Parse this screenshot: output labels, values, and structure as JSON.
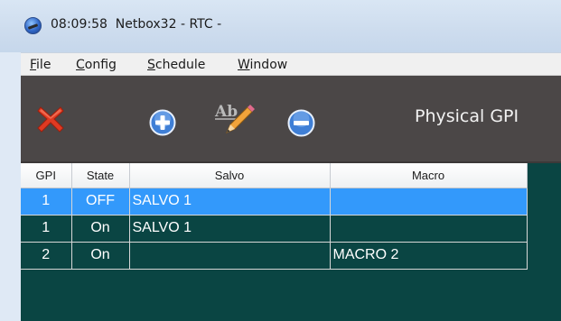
{
  "window": {
    "time": "08:09:58",
    "app": "Netbox32",
    "separator1": "-",
    "mode": "RTC",
    "separator2": "-"
  },
  "menu": [
    {
      "key": "F",
      "rest": "ile"
    },
    {
      "key": "C",
      "rest": "onfig"
    },
    {
      "key": "S",
      "rest": "chedule"
    },
    {
      "key": "W",
      "rest": "indow"
    }
  ],
  "toolbar": {
    "delete_icon": "red-x-icon",
    "add_icon": "plus-circle-icon",
    "rename_icon": "ab-pencil-icon",
    "remove_icon": "minus-circle-icon",
    "panel_title": "Physical GPI"
  },
  "table": {
    "headers": {
      "gpi": "GPI",
      "state": "State",
      "salvo": "Salvo",
      "macro": "Macro"
    },
    "rows": [
      {
        "gpi": "1",
        "state": "OFF",
        "salvo": "SALVO 1",
        "macro": ""
      },
      {
        "gpi": "1",
        "state": "On",
        "salvo": "SALVO 1",
        "macro": ""
      },
      {
        "gpi": "2",
        "state": "On",
        "salvo": "",
        "macro": "MACRO 2"
      }
    ],
    "selected_row": 0
  },
  "colors": {
    "toolbar_bg": "#4b4747",
    "grid_bg": "#0a4543",
    "selection": "#3399fb"
  }
}
